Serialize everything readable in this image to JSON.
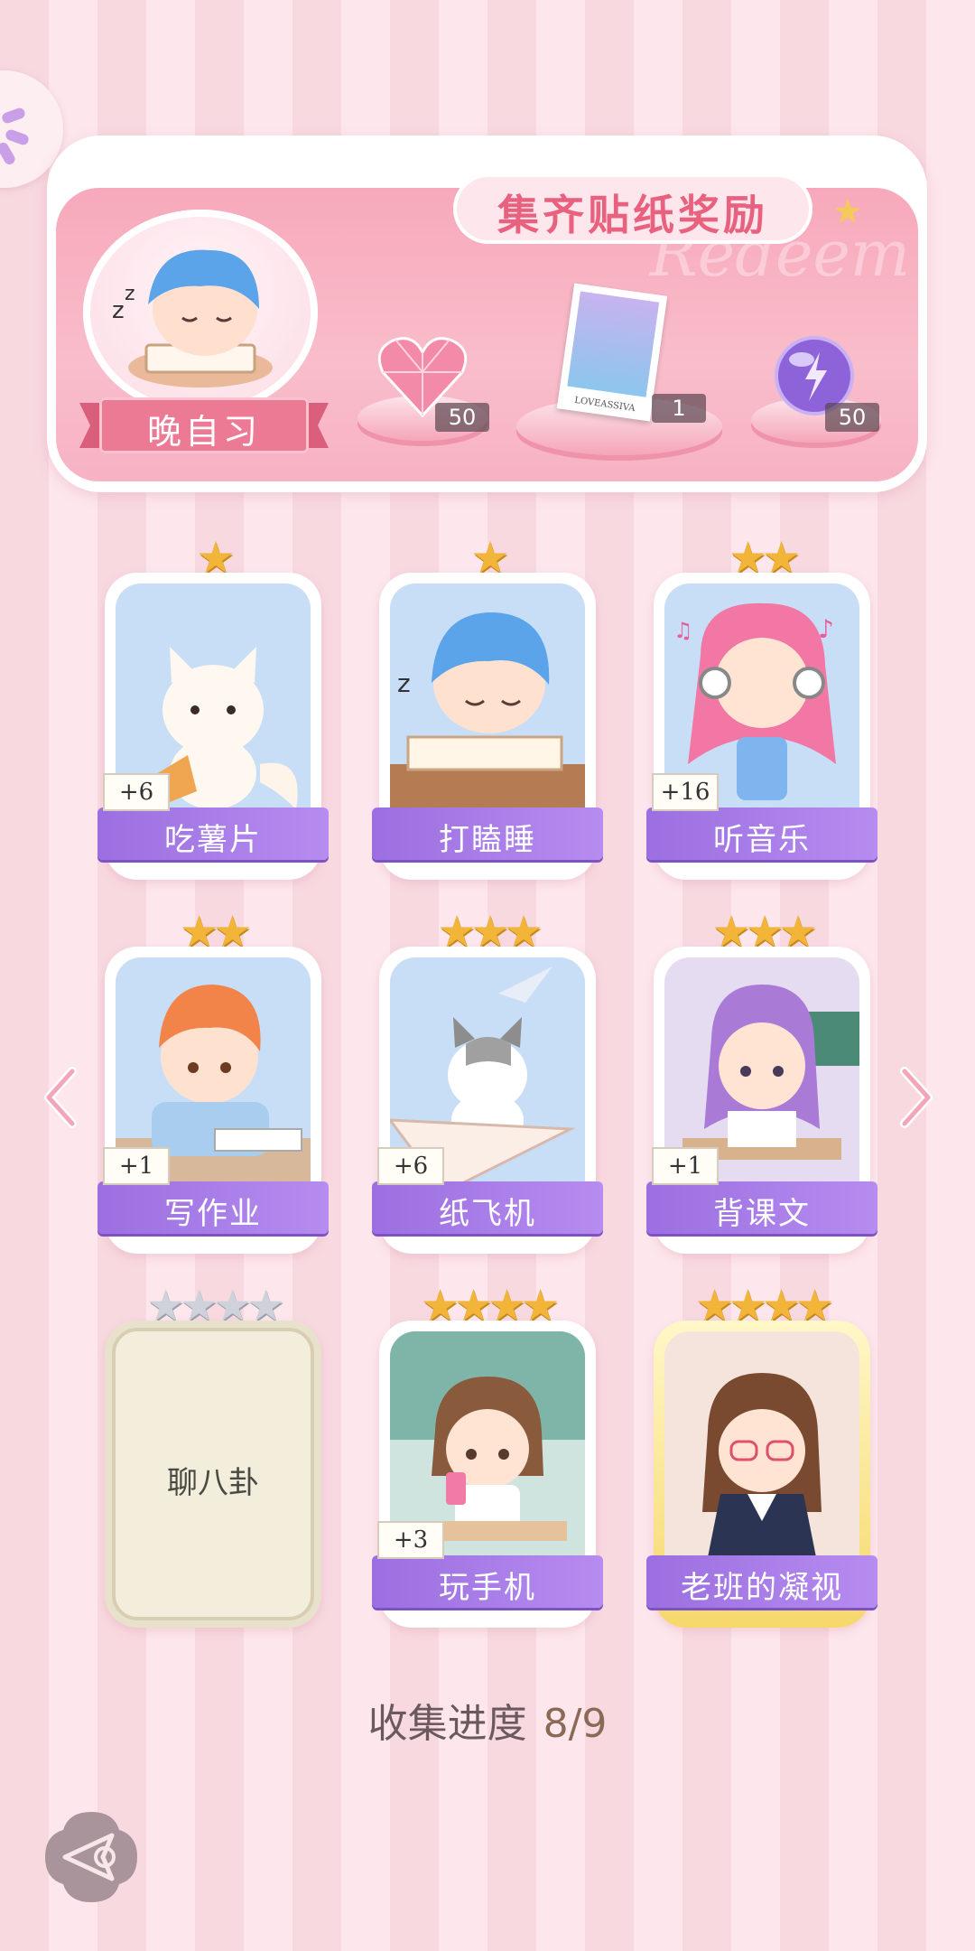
{
  "reward_panel": {
    "title": "集齐贴纸奖励",
    "watermark": "Redeem",
    "theme_label": "晚自习",
    "rewards": [
      {
        "icon": "pink-heart-gem-icon",
        "count": "50"
      },
      {
        "icon": "postcard-icon",
        "count": "1",
        "card_caption": "LOVEASSIVA"
      },
      {
        "icon": "purple-energy-orb-icon",
        "count": "50"
      }
    ]
  },
  "stickers": [
    {
      "name": "吃薯片",
      "stars": 1,
      "bonus": "+6",
      "icon": "white-cat-chips-icon",
      "locked": false
    },
    {
      "name": "打瞌睡",
      "stars": 1,
      "bonus": "",
      "icon": "sleeping-boy-icon",
      "locked": false
    },
    {
      "name": "听音乐",
      "stars": 2,
      "bonus": "+16",
      "icon": "music-girl-icon",
      "locked": false
    },
    {
      "name": "写作业",
      "stars": 2,
      "bonus": "+1",
      "icon": "homework-boy-icon",
      "locked": false
    },
    {
      "name": "纸飞机",
      "stars": 3,
      "bonus": "+6",
      "icon": "paper-plane-cat-icon",
      "locked": false
    },
    {
      "name": "背课文",
      "stars": 3,
      "bonus": "+1",
      "icon": "reciting-girl-icon",
      "locked": false
    },
    {
      "name": "聊八卦",
      "stars": 4,
      "bonus": "",
      "icon": "locked-card-icon",
      "locked": true
    },
    {
      "name": "玩手机",
      "stars": 4,
      "bonus": "+3",
      "icon": "phone-girl-icon",
      "locked": false
    },
    {
      "name": "老班的凝视",
      "stars": 4,
      "bonus": "",
      "icon": "teacher-gaze-icon",
      "locked": false
    }
  ],
  "progress": {
    "label": "收集进度",
    "value": "8/9"
  },
  "colors": {
    "accent": "#9b6fe0",
    "pink": "#ec7a95",
    "star": "#f2b53a"
  }
}
